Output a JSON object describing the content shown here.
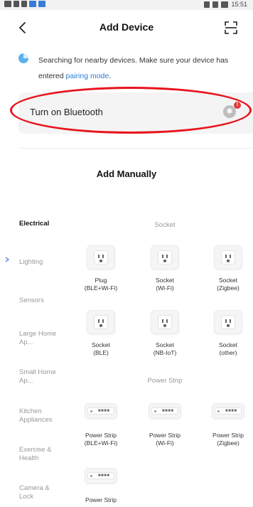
{
  "status_bar": {
    "time": "15:51"
  },
  "header": {
    "title": "Add Device",
    "back_icon": "chevron-left-icon",
    "scan_icon": "scan-icon"
  },
  "search": {
    "text": "Searching for nearby devices. Make sure your device has entered ",
    "link": "pairing mode",
    "suffix": "."
  },
  "bluetooth": {
    "label": "Turn on Bluetooth",
    "badge": "!",
    "icon": "bluetooth-icon"
  },
  "manual": {
    "title": "Add Manually"
  },
  "categories": [
    {
      "label": "Electrical",
      "active": true
    },
    {
      "label": "Lighting"
    },
    {
      "label": "Sensors"
    },
    {
      "label": "Large Home Ap..."
    },
    {
      "label": "Small Home Ap..."
    },
    {
      "label": "Kitchen Appliances"
    },
    {
      "label": "Exercise & Health"
    },
    {
      "label": "Camera & Lock"
    }
  ],
  "groups": {
    "socket": "Socket",
    "power_strip": "Power Strip"
  },
  "sockets": [
    {
      "l1": "Plug",
      "l2": "(BLE+Wi-Fi)"
    },
    {
      "l1": "Socket",
      "l2": "(Wi-Fi)"
    },
    {
      "l1": "Socket",
      "l2": "(Zigbee)"
    },
    {
      "l1": "Socket",
      "l2": "(BLE)"
    },
    {
      "l1": "Socket",
      "l2": "(NB-IoT)"
    },
    {
      "l1": "Socket",
      "l2": "(other)"
    }
  ],
  "strips": [
    {
      "l1": "Power Strip",
      "l2": "(BLE+Wi-Fi)"
    },
    {
      "l1": "Power Strip",
      "l2": "(Wi-Fi)"
    },
    {
      "l1": "Power Strip",
      "l2": "(Zigbee)"
    },
    {
      "l1": "Power Strip",
      "l2": ""
    }
  ],
  "colors": {
    "accent": "#2a7fd4",
    "highlight": "#e8141c",
    "card_bg": "#f4f4f4"
  }
}
